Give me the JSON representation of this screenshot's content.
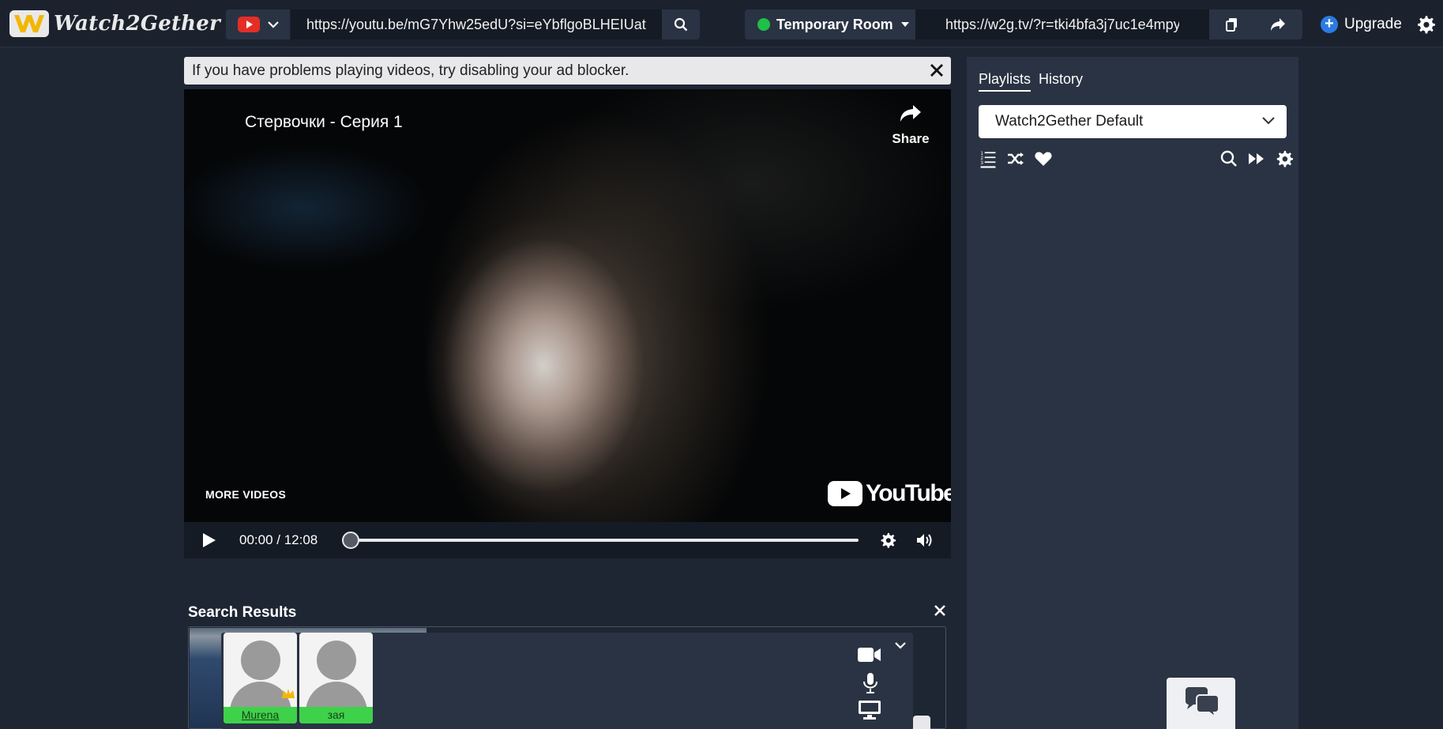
{
  "app": {
    "name": "Watch2Gether"
  },
  "header": {
    "provider": "youtube",
    "video_url": "https://youtu.be/mG7Yhw25edU?si=eYbflgoBLHEIUatA",
    "room_label": "Temporary Room",
    "room_url": "https://w2g.tv/?r=tki4bfa3j7uc1e4mpy",
    "upgrade_label": "Upgrade"
  },
  "notice": {
    "text": "If you have problems playing videos, try disabling your ad blocker."
  },
  "player": {
    "title": "Стервочки - Серия 1",
    "share_label": "Share",
    "more_videos_label": "MORE VIDEOS",
    "brand_label": "YouTube",
    "time_display": "00:00 / 12:08",
    "progress": 0
  },
  "sidebar": {
    "tabs": [
      {
        "label": "Playlists",
        "active": true
      },
      {
        "label": "History",
        "active": false
      }
    ],
    "selected_playlist": "Watch2Gether Default",
    "toolbar_icons": [
      "list-icon",
      "shuffle-icon",
      "heart-icon",
      "search-icon",
      "fast-forward-icon",
      "gear-icon"
    ]
  },
  "search_results": {
    "title": "Search Results"
  },
  "video_chat": {
    "participants": [
      {
        "name": "Murena",
        "is_host": true
      },
      {
        "name": "зая",
        "is_host": false
      }
    ]
  },
  "colors": {
    "page_bg": "#1e2634",
    "panel_bg": "#2a3343",
    "accent_green": "#1fbf48",
    "accent_blue": "#2b7be4",
    "youtube_red": "#e52d27"
  }
}
